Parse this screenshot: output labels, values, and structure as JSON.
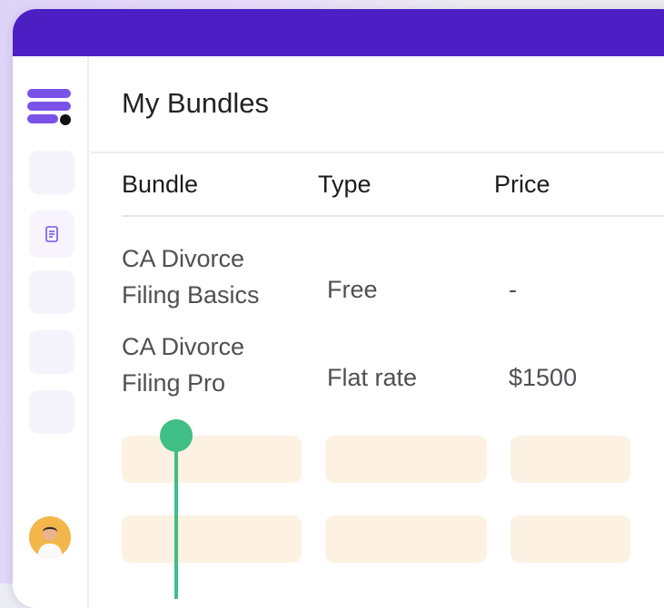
{
  "app": {
    "accent_color": "#4b1fc4",
    "logo_color": "#7b52e8",
    "cursor_color": "#3fbf85"
  },
  "sidebar": {
    "logo_icon": "stacked-bars-logo",
    "active_item_icon": "document-list-icon",
    "avatar_icon": "user-avatar"
  },
  "page": {
    "title": "My Bundles"
  },
  "table": {
    "columns": [
      "Bundle",
      "Type",
      "Price"
    ],
    "rows": [
      {
        "bundle_line1": "CA Divorce",
        "bundle_line2": "Filing Basics",
        "type": "Free",
        "price": "-"
      },
      {
        "bundle_line1": "CA Divorce",
        "bundle_line2": "Filing Pro",
        "type": "Flat rate",
        "price": "$1500"
      }
    ]
  }
}
